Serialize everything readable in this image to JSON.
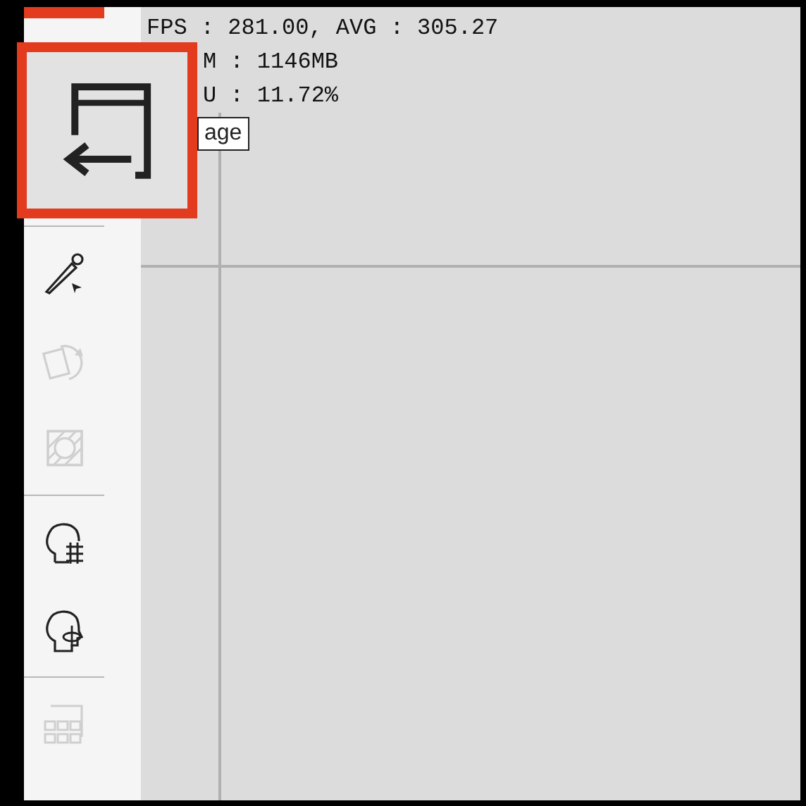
{
  "stats": [
    "FPS : 281.00, AVG : 305.27",
    "M : 1146MB",
    "U : 11.72%"
  ],
  "tooltip": "age",
  "tools": [
    {
      "kind": "divider"
    },
    {
      "kind": "pen",
      "disabled": false
    },
    {
      "kind": "rotate",
      "disabled": true
    },
    {
      "kind": "hatch",
      "disabled": true
    },
    {
      "kind": "divider"
    },
    {
      "kind": "head-grid",
      "disabled": false
    },
    {
      "kind": "head-rotate",
      "disabled": false
    },
    {
      "kind": "divider"
    },
    {
      "kind": "grid",
      "disabled": true
    }
  ]
}
